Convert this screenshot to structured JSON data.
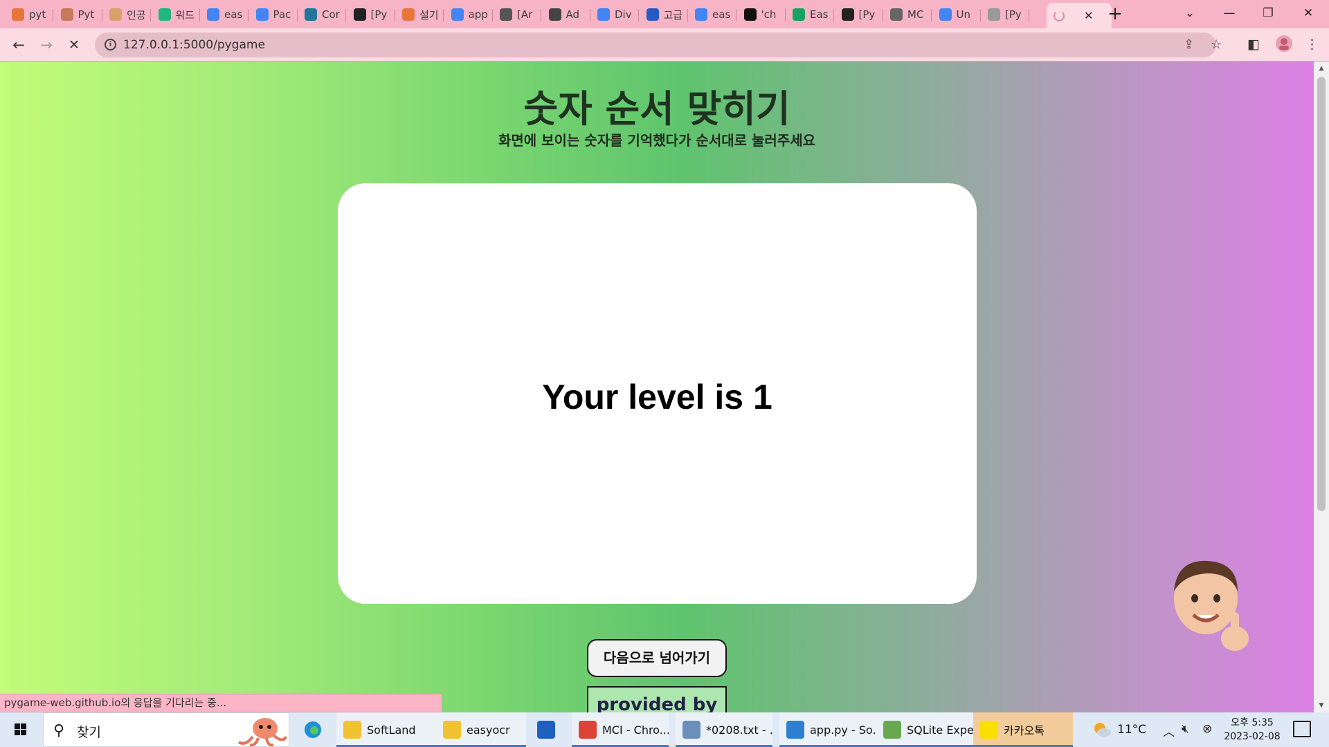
{
  "browser": {
    "tabs": [
      {
        "label": "pyt",
        "icon": "flame-icon",
        "color": "#e8753a"
      },
      {
        "label": "Pyt",
        "icon": "user-photo-icon",
        "color": "#c77a5a"
      },
      {
        "label": "인공",
        "icon": "illustration-icon",
        "color": "#d7a16a"
      },
      {
        "label": "워드",
        "icon": "m-logo-icon",
        "color": "#1fb67f"
      },
      {
        "label": "eas",
        "icon": "google-icon",
        "color": "#4285f4"
      },
      {
        "label": "Pac",
        "icon": "google-icon",
        "color": "#4285f4"
      },
      {
        "label": "Cor",
        "icon": "wordpress-icon",
        "color": "#21759b"
      },
      {
        "label": "[Py",
        "icon": "dots-icon",
        "color": "#222222"
      },
      {
        "label": "설기",
        "icon": "flame-icon",
        "color": "#e8753a"
      },
      {
        "label": "app",
        "icon": "google-icon",
        "color": "#4285f4"
      },
      {
        "label": "[Ar",
        "icon": "feather-icon",
        "color": "#555555"
      },
      {
        "label": "Ad",
        "icon": "openai-icon",
        "color": "#444444"
      },
      {
        "label": "Div",
        "icon": "google-icon",
        "color": "#4285f4"
      },
      {
        "label": "고급",
        "icon": "x-logo-icon",
        "color": "#2b59c3"
      },
      {
        "label": "eas",
        "icon": "google-icon",
        "color": "#4285f4"
      },
      {
        "label": "'ch",
        "icon": "github-icon",
        "color": "#111111"
      },
      {
        "label": "Eas",
        "icon": "v-logo-icon",
        "color": "#1aa260"
      },
      {
        "label": "[Py",
        "icon": "dots-icon",
        "color": "#222222"
      },
      {
        "label": "MC",
        "icon": "globe-icon",
        "color": "#666666"
      },
      {
        "label": "Un",
        "icon": "google-icon",
        "color": "#4285f4"
      },
      {
        "label": "[Py",
        "icon": "google-outline-icon",
        "color": "#999999"
      }
    ],
    "active_tab": {
      "icon": "loading-spinner-icon",
      "close": "✕"
    },
    "new_tab": "+",
    "window_controls": {
      "list": "⌄",
      "minimize": "—",
      "maximize": "❐",
      "close": "✕"
    },
    "nav": {
      "back": "←",
      "forward": "→",
      "stop": "✕"
    },
    "url": "127.0.0.1:5000/pygame",
    "toolbar_icons": [
      "share-icon",
      "star-icon",
      "sidepanel-icon",
      "profile-icon",
      "menu-icon"
    ]
  },
  "page": {
    "title": "숫자 순서 맞히기",
    "subtitle": "화면에 보이는 숫자를 기억했다가 순서대로 눌러주세요",
    "level_text": "Your level is 1",
    "next_button": "다음으로 넘어가기",
    "provided_by": "provided by"
  },
  "status_bar": "pygame-web.github.io의 응답을 기다리는 중...",
  "taskbar": {
    "search_placeholder": "찾기",
    "items": [
      {
        "label": "SoftLand",
        "icon": "folder-icon",
        "color": "#f1c232",
        "open": true
      },
      {
        "label": "easyocr",
        "icon": "folder-icon",
        "color": "#f1c232",
        "open": true
      },
      {
        "label": "",
        "icon": "mail-icon",
        "color": "#1f5fbf",
        "open": false
      },
      {
        "label": "MCI - Chro...",
        "icon": "chrome-icon",
        "color": "#db4437",
        "open": true
      },
      {
        "label": "*0208.txt - ...",
        "icon": "notepad-icon",
        "color": "#6a8fb8",
        "open": true
      },
      {
        "label": "app.py - So...",
        "icon": "vscode-icon",
        "color": "#2d7fd0",
        "open": true
      },
      {
        "label": "SQLite Expe...",
        "icon": "sqlite-icon",
        "color": "#6aa84f",
        "open": true
      },
      {
        "label": "카카오톡",
        "icon": "kakaotalk-icon",
        "color": "#f9e000",
        "open": true
      }
    ],
    "weather": "11°C",
    "clock_line1": "오후 5:35",
    "clock_line2": "2023-02-08"
  }
}
